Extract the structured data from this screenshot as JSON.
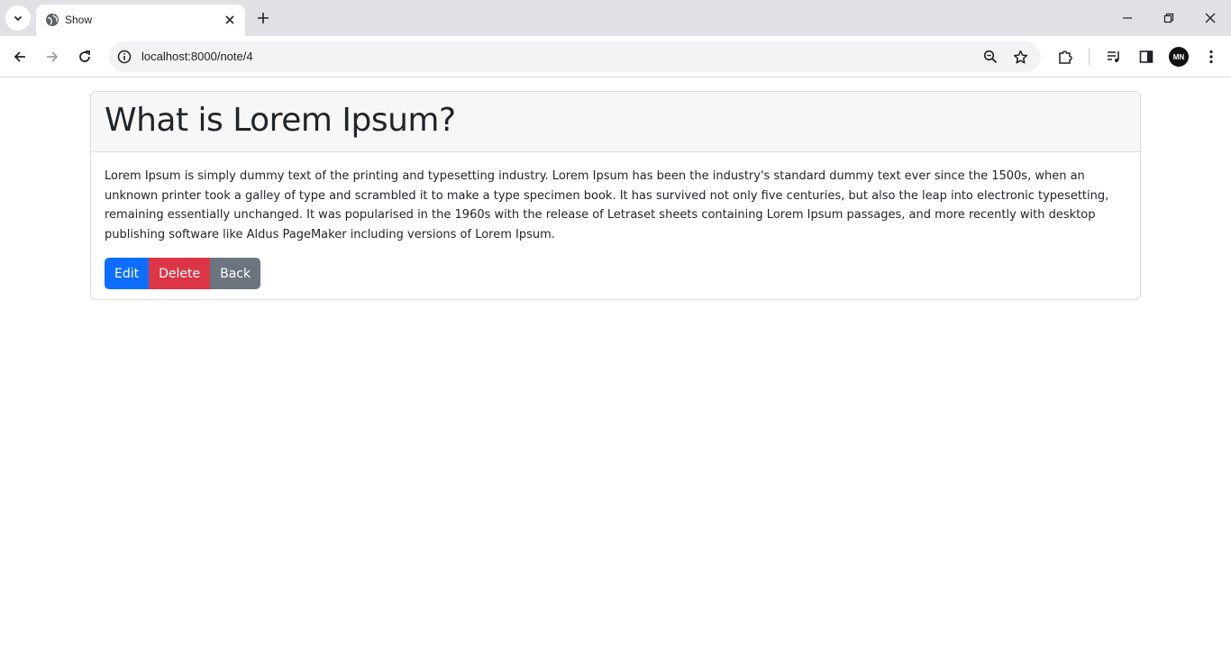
{
  "browser": {
    "tab": {
      "title": "Show",
      "favicon": "globe-icon"
    },
    "url": "localhost:8000/note/4",
    "profile_initials": "MN"
  },
  "note": {
    "title": "What is Lorem Ipsum?",
    "body": "Lorem Ipsum is simply dummy text of the printing and typesetting industry. Lorem Ipsum has been the industry's standard dummy text ever since the 1500s, when an unknown printer took a galley of type and scrambled it to make a type specimen book. It has survived not only five centuries, but also the leap into electronic typesetting, remaining essentially unchanged. It was popularised in the 1960s with the release of Letraset sheets containing Lorem Ipsum passages, and more recently with desktop publishing software like Aldus PageMaker including versions of Lorem Ipsum."
  },
  "actions": {
    "edit_label": "Edit",
    "delete_label": "Delete",
    "back_label": "Back"
  },
  "colors": {
    "edit": "#0d6efd",
    "delete": "#dc3545",
    "back": "#6c757d"
  }
}
